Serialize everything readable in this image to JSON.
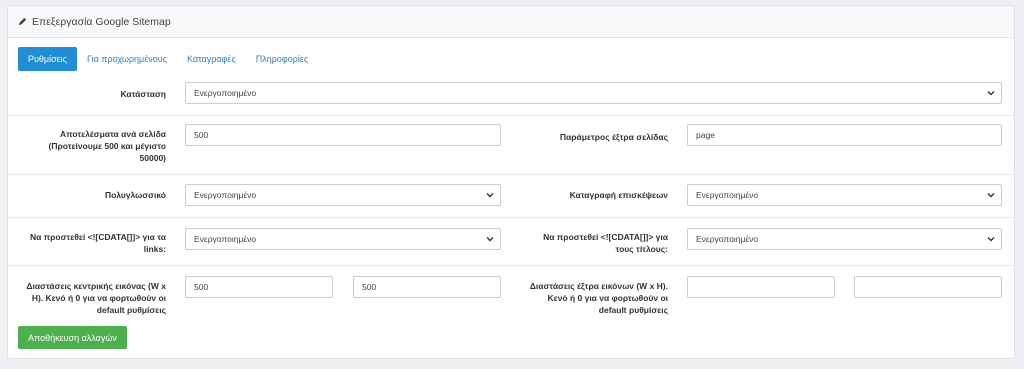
{
  "header": {
    "title": "Επεξεργασία Google Sitemap"
  },
  "tabs": [
    {
      "label": "Ρυθμίσεις"
    },
    {
      "label": "Για προχωρημένους"
    },
    {
      "label": "Καταγραφές"
    },
    {
      "label": "Πληροφορίες"
    }
  ],
  "form": {
    "status": {
      "label": "Κατάσταση",
      "value": "Ενεργοποιημένο"
    },
    "results_per_page": {
      "label": "Αποτελέσματα ανά σελίδα (Προτείνουμε 500 και μέγιστο 50000)",
      "value": "500"
    },
    "extra_page_param": {
      "label": "Παράμετρος έξτρα σελίδας",
      "value": "page"
    },
    "multilingual": {
      "label": "Πολυγλωσσικό",
      "value": "Ενεργοποιημένο"
    },
    "visit_log": {
      "label": "Καταγραφή επισκέψεων",
      "value": "Ενεργοποιημένο"
    },
    "cdata_links": {
      "label": "Να προστεθεί <![CDATA[]]> για τα links:",
      "value": "Ενεργοποιημένο"
    },
    "cdata_titles": {
      "label": "Να προστεθεί <![CDATA[]]> για τους τίτλους:",
      "value": "Ενεργοποιημένο"
    },
    "main_image_dims": {
      "label": "Διαστάσεις κεντρικής εικόνας (W x H). Κενό ή 0 για να φορτωθούν οι default ρυθμίσεις",
      "width": "500",
      "height": "500"
    },
    "extra_image_dims": {
      "label": "Διαστάσεις έξτρα εικόνων (W x H). Κενό ή 0 για να φορτωθούν οι default ρυθμίσεις",
      "width": "",
      "height": ""
    }
  },
  "save_button": {
    "label": "Αποθήκευση αλλαγών"
  },
  "colors": {
    "tab_active": "#1f8ed6",
    "save_button": "#4cb04d",
    "link": "#2a84c8"
  },
  "icons": {
    "header": "pencil-icon",
    "select": "chevron-down-icon"
  }
}
